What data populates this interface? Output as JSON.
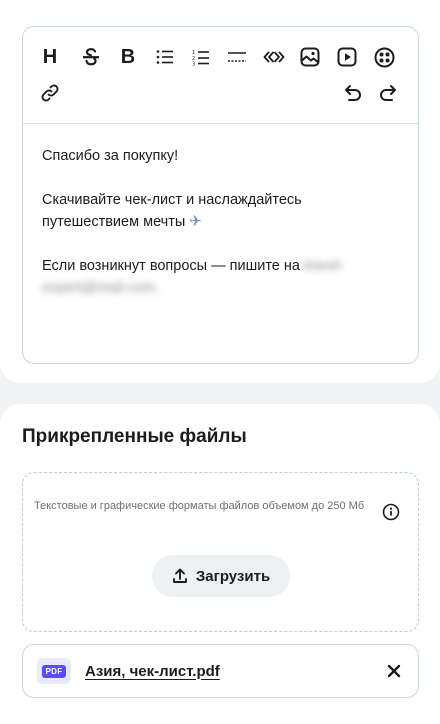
{
  "editor": {
    "toolbar": {
      "heading_glyph": "H",
      "bold_glyph": "B",
      "icons": [
        "heading-icon",
        "strikethrough-icon",
        "bold-icon",
        "bullet-list-icon",
        "numbered-list-icon",
        "horizontal-rule-icon",
        "quote-icon",
        "image-icon",
        "video-icon",
        "emoji-icon",
        "link-icon",
        "undo-icon",
        "redo-icon"
      ]
    },
    "content": {
      "line1": "Спасибо за покупку!",
      "line2": "Скачивайте чек-лист и наслаждайтесь путешествием мечты",
      "line2_emoji": "✈",
      "line3_prefix": "Если возникнут вопросы — пишите на",
      "line3_email": "travel-expert@mail.com."
    }
  },
  "attachments": {
    "title": "Прикрепленные файлы",
    "hint": "Текстовые и графические форматы файлов объемом до 250 Мб",
    "upload_label": "Загрузить",
    "file": {
      "badge": "PDF",
      "name": "Азия, чек-лист.pdf"
    }
  },
  "colors": {
    "border": "#c8d5e3",
    "pdf_badge": "#5b4bff",
    "upload_bg": "#eef1f4"
  }
}
